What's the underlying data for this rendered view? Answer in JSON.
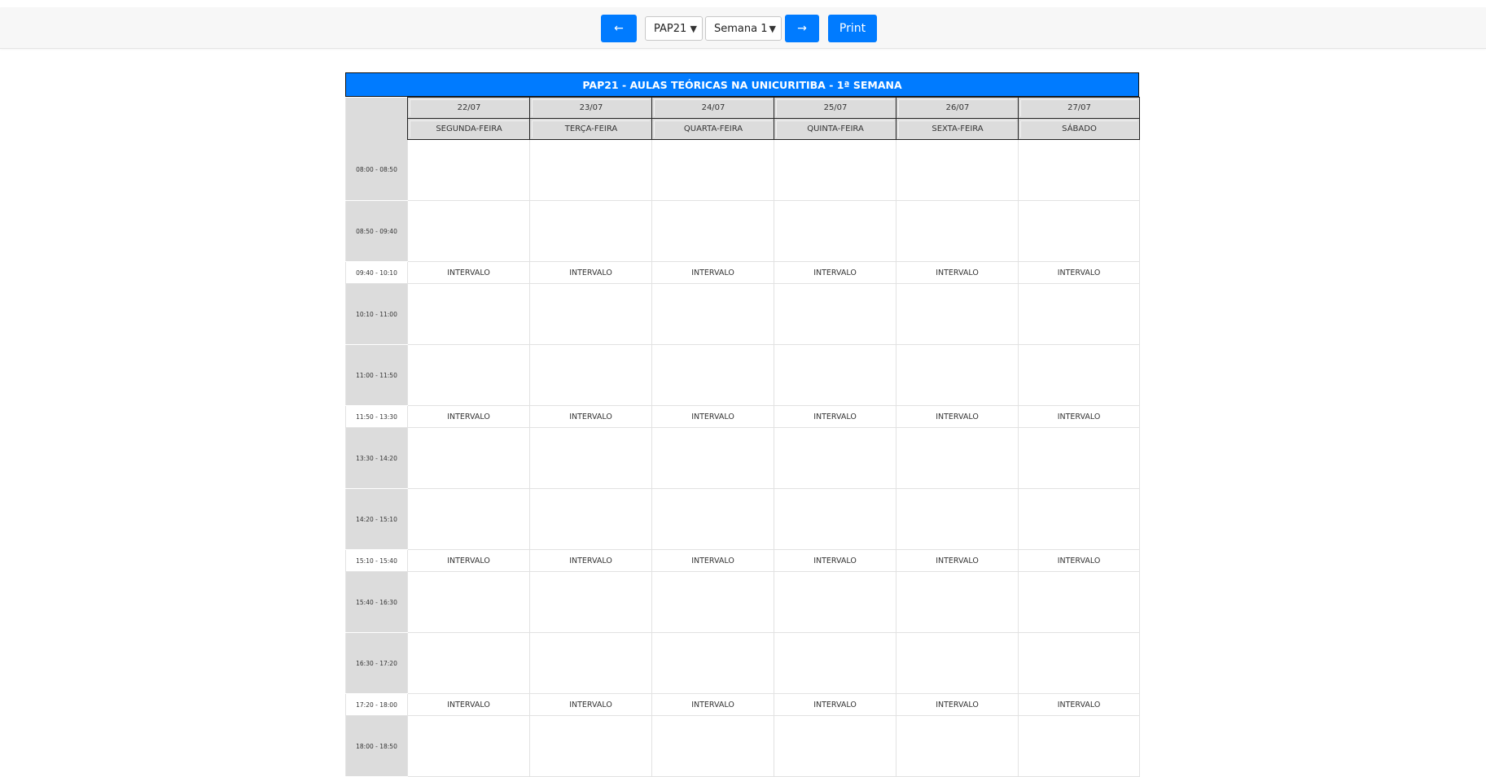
{
  "toolbar": {
    "prev_label": "←",
    "next_label": "→",
    "print_label": "Print",
    "turma_selected": "PAP21",
    "semana_selected": "Semana 1"
  },
  "schedule": {
    "title": "PAP21 - AULAS TEÓRICAS NA UNICURITIBA - 1ª SEMANA",
    "dates": [
      "22/07",
      "23/07",
      "24/07",
      "25/07",
      "26/07",
      "27/07"
    ],
    "weekdays": [
      "SEGUNDA-FEIRA",
      "TERÇA-FEIRA",
      "QUARTA-FEIRA",
      "QUINTA-FEIRA",
      "SEXTA-FEIRA",
      "SÁBADO"
    ],
    "break_label": "INTERVALO",
    "rows": [
      {
        "time": "08:00 - 08:50",
        "type": "slot"
      },
      {
        "time": "08:50 - 09:40",
        "type": "slot"
      },
      {
        "time": "09:40 - 10:10",
        "type": "break"
      },
      {
        "time": "10:10 - 11:00",
        "type": "slot"
      },
      {
        "time": "11:00 - 11:50",
        "type": "slot"
      },
      {
        "time": "11:50 - 13:30",
        "type": "break"
      },
      {
        "time": "13:30 - 14:20",
        "type": "slot"
      },
      {
        "time": "14:20 - 15:10",
        "type": "slot"
      },
      {
        "time": "15:10 - 15:40",
        "type": "break"
      },
      {
        "time": "15:40 - 16:30",
        "type": "slot"
      },
      {
        "time": "16:30 - 17:20",
        "type": "slot"
      },
      {
        "time": "17:20 - 18:00",
        "type": "break"
      },
      {
        "time": "18:00 - 18:50",
        "type": "slot"
      }
    ]
  }
}
